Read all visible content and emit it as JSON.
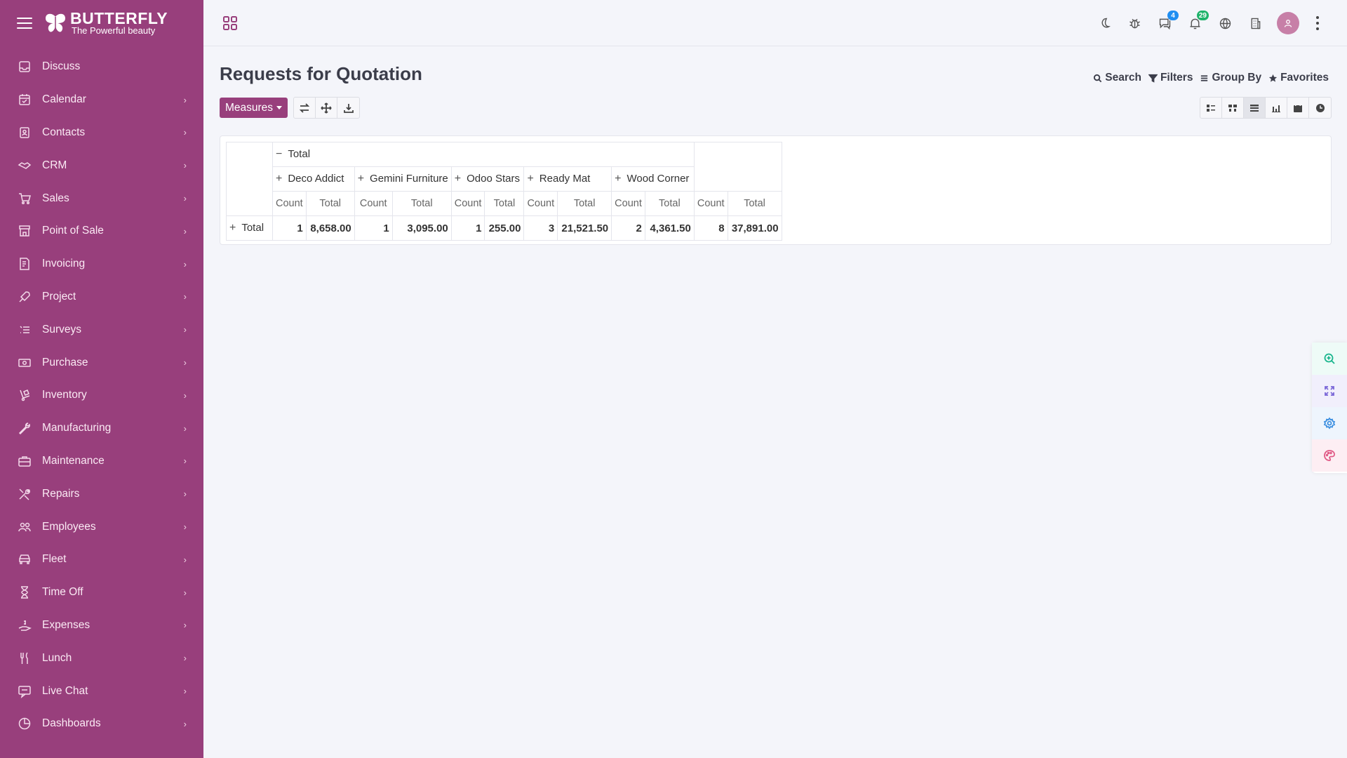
{
  "app": {
    "brand": "BUTTERFLY",
    "tagline": "The Powerful beauty"
  },
  "sidebar": {
    "items": [
      {
        "label": "Discuss",
        "icon": "inbox-icon",
        "has_children": false
      },
      {
        "label": "Calendar",
        "icon": "calendar-icon",
        "has_children": true
      },
      {
        "label": "Contacts",
        "icon": "contacts-icon",
        "has_children": true
      },
      {
        "label": "CRM",
        "icon": "handshake-icon",
        "has_children": true
      },
      {
        "label": "Sales",
        "icon": "cart-icon",
        "has_children": true
      },
      {
        "label": "Point of Sale",
        "icon": "store-icon",
        "has_children": true
      },
      {
        "label": "Invoicing",
        "icon": "invoice-icon",
        "has_children": true
      },
      {
        "label": "Project",
        "icon": "rocket-icon",
        "has_children": true
      },
      {
        "label": "Surveys",
        "icon": "list-icon",
        "has_children": true
      },
      {
        "label": "Purchase",
        "icon": "cash-icon",
        "has_children": true
      },
      {
        "label": "Inventory",
        "icon": "dolly-icon",
        "has_children": true
      },
      {
        "label": "Manufacturing",
        "icon": "wrench-icon",
        "has_children": true
      },
      {
        "label": "Maintenance",
        "icon": "briefcase-icon",
        "has_children": true
      },
      {
        "label": "Repairs",
        "icon": "tools-icon",
        "has_children": true
      },
      {
        "label": "Employees",
        "icon": "users-icon",
        "has_children": true
      },
      {
        "label": "Fleet",
        "icon": "car-icon",
        "has_children": true
      },
      {
        "label": "Time Off",
        "icon": "hourglass-icon",
        "has_children": true
      },
      {
        "label": "Expenses",
        "icon": "hand-dollar-icon",
        "has_children": true
      },
      {
        "label": "Lunch",
        "icon": "utensils-icon",
        "has_children": true
      },
      {
        "label": "Live Chat",
        "icon": "chat-icon",
        "has_children": true
      },
      {
        "label": "Dashboards",
        "icon": "pie-icon",
        "has_children": true
      }
    ]
  },
  "topbar": {
    "messages_count": "4",
    "notifications_count": "29"
  },
  "page": {
    "title": "Requests for Quotation"
  },
  "search_options": {
    "search": "Search",
    "filters": "Filters",
    "group_by": "Group By",
    "favorites": "Favorites"
  },
  "toolbar": {
    "measures": "Measures"
  },
  "pivot": {
    "top_header": "Total",
    "columns": [
      {
        "name": "Deco Addict",
        "count": "1",
        "total": "8,658.00"
      },
      {
        "name": "Gemini Furniture",
        "count": "1",
        "total": "3,095.00"
      },
      {
        "name": "Odoo Stars",
        "count": "1",
        "total": "255.00"
      },
      {
        "name": "Ready Mat",
        "count": "3",
        "total": "21,521.50"
      },
      {
        "name": "Wood Corner",
        "count": "2",
        "total": "4,361.50"
      }
    ],
    "grand": {
      "count": "8",
      "total": "37,891.00"
    },
    "measure_count": "Count",
    "measure_total": "Total",
    "row_header": "Total"
  }
}
